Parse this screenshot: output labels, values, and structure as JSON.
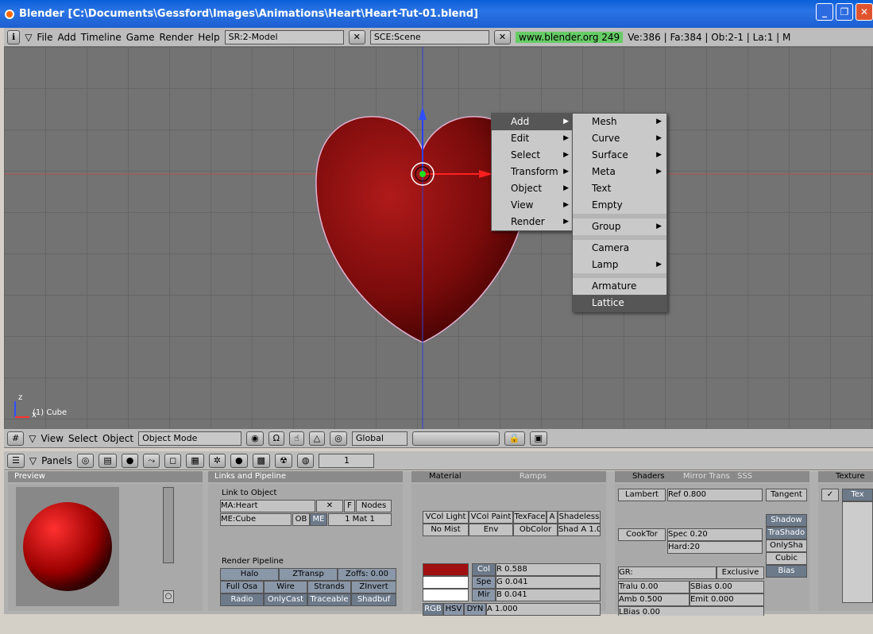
{
  "window": {
    "title": "Blender [C:\\Documents\\Gessford\\Images\\Animations\\Heart\\Heart-Tut-01.blend]"
  },
  "topbar": {
    "menus": [
      "File",
      "Add",
      "Timeline",
      "Game",
      "Render",
      "Help"
    ],
    "screen": "SR:2-Model",
    "scene": "SCE:Scene",
    "url": "www.blender.org 249",
    "stats": "Ve:386 | Fa:384 | Ob:2-1 | La:1 | M"
  },
  "viewport": {
    "object_label": "(1) Cube",
    "axis_z": "z",
    "axis_x": "x"
  },
  "menu_main": [
    "Add",
    "Edit",
    "Select",
    "Transform",
    "Object",
    "View",
    "Render"
  ],
  "menu_add": [
    "Mesh",
    "Curve",
    "Surface",
    "Meta",
    "Text",
    "Empty",
    "Group",
    "Camera",
    "Lamp",
    "Armature",
    "Lattice"
  ],
  "header3d": {
    "view": "View",
    "select": "Select",
    "object": "Object",
    "mode": "Object Mode",
    "orient": "Global"
  },
  "buttons_header": {
    "panels": "Panels",
    "frame": "1"
  },
  "preview": {
    "title": "Preview"
  },
  "links": {
    "title": "Links and Pipeline",
    "link_to_object": "Link to Object",
    "material": "MA:Heart",
    "f": "F",
    "nodes": "Nodes",
    "mesh": "ME:Cube",
    "ob": "OB",
    "me": "ME",
    "mat": "1 Mat 1",
    "render_pipeline": "Render Pipeline",
    "halo": "Halo",
    "ztransp": "ZTransp",
    "zoffs": "Zoffs: 0.00",
    "fullosa": "Full Osa",
    "wire": "Wire",
    "strands": "Strands",
    "zinvert": "ZInvert",
    "radio": "Radio",
    "onlycast": "OnlyCast",
    "traceable": "Traceable",
    "shadbuf": "Shadbuf"
  },
  "material": {
    "tab": "Material",
    "ramps": "Ramps",
    "vcol_light": "VCol Light",
    "vcol_paint": "VCol Paint",
    "texface": "TexFace",
    "a": "A",
    "shadeless": "Shadeless",
    "nomist": "No Mist",
    "env": "Env",
    "obcolor": "ObColor",
    "shad_a": "Shad A 1.00",
    "col": "Col",
    "spe": "Spe",
    "mir": "Mir",
    "r": "R 0.588",
    "g": "G 0.041",
    "b": "B 0.041",
    "rgb": "RGB",
    "hsv": "HSV",
    "dyn": "DYN",
    "alpha": "A 1.000",
    "color_col": "#a01010"
  },
  "shaders": {
    "tab": "Shaders",
    "mirror": "Mirror Trans",
    "sss": "SSS",
    "lambert": "Lambert",
    "ref": "Ref  0.800",
    "tangent": "Tangent",
    "cooktor": "CookTor",
    "spec": "Spec 0.20",
    "hard": "Hard:20",
    "shadow": "Shadow",
    "trashado": "TraShado",
    "onlysha": "OnlySha",
    "cubic": "Cubic",
    "bias": "Bias",
    "gr": "GR:",
    "exclusive": "Exclusive",
    "tralu": "Tralu 0.00",
    "sbias": "SBias 0.00",
    "amb": "Amb 0.500",
    "emit": "Emit 0.000",
    "lbias": "LBias 0.00"
  },
  "texture": {
    "tab": "Texture",
    "tex": "Tex"
  }
}
